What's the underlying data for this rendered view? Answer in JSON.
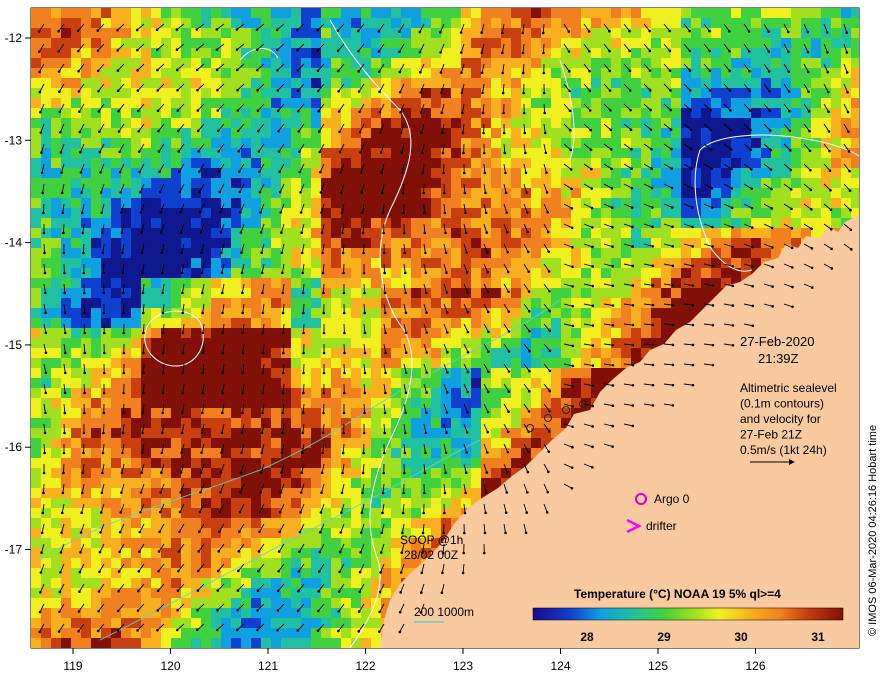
{
  "map": {
    "lon_ticks": [
      "119",
      "120",
      "121",
      "122",
      "123",
      "124",
      "125",
      "126"
    ],
    "lat_ticks": [
      "-12",
      "-13",
      "-14",
      "-15",
      "-16",
      "-17"
    ],
    "date_label": "27-Feb-2020",
    "time_label": "21:39Z",
    "altimetry_note": [
      "Altimetric sealevel",
      "(0.1m contours)",
      "and velocity for",
      "27-Feb 21Z",
      "0.5m/s (1kt 24h)"
    ],
    "legend_argo": "Argo 0",
    "legend_drifter": "drifter",
    "soop_line1": "SOOP @1h",
    "soop_line2": "28/02 00Z",
    "depth_legend": "200  1000m",
    "colorbar_title": "Temperature (°C) NOAA 19 5% ql>=4",
    "colorbar_ticks": [
      "28",
      "29",
      "30",
      "31"
    ],
    "credit": "© IMOS 06-Mar-2020 04:26:16 Hobart time",
    "colors": {
      "land": "#f9c9a0",
      "argo": "#d000d0",
      "drifter": "#ff00ff",
      "contour": "#ffffff",
      "depth": "#58d8c8"
    }
  }
}
